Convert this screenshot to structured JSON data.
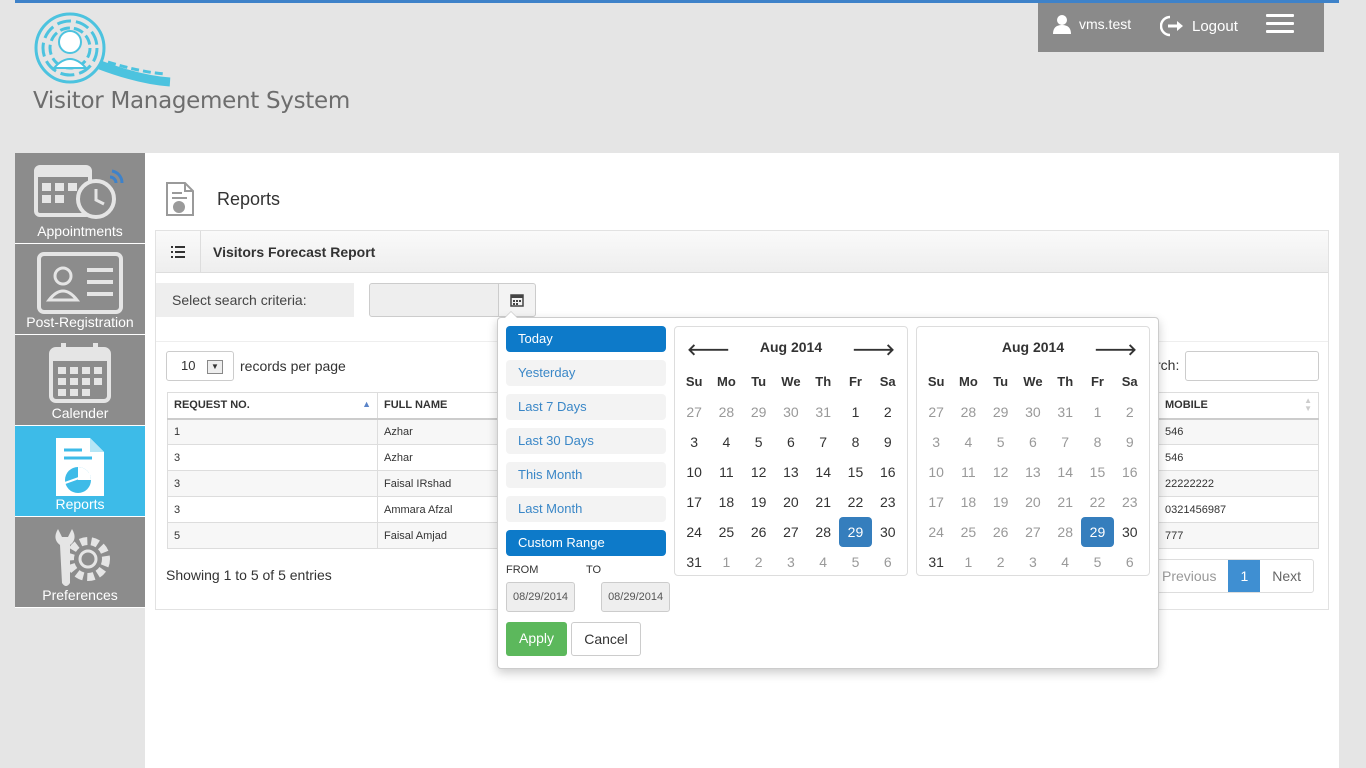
{
  "app": {
    "title": "Visitor Management System"
  },
  "header": {
    "username": "vms.test",
    "logout": "Logout"
  },
  "sidebar": {
    "items": [
      {
        "label": "Appointments"
      },
      {
        "label": "Post-Registration"
      },
      {
        "label": "Calender"
      },
      {
        "label": "Reports"
      },
      {
        "label": "Preferences"
      }
    ]
  },
  "page": {
    "title": "Reports"
  },
  "panel": {
    "title": "Visitors Forecast Report",
    "criteria_label": "Select search criteria:",
    "criteria_value": ""
  },
  "table_controls": {
    "records_per_page_value": "10",
    "records_per_page_label": "records per page",
    "search_label": "rch:",
    "search_value": ""
  },
  "table": {
    "headers": [
      "REQUEST NO.",
      "FULL NAME",
      "MOBILE"
    ],
    "rows": [
      {
        "request_no": "1",
        "full_name": "Azhar",
        "mobile": "546"
      },
      {
        "request_no": "3",
        "full_name": "Azhar",
        "mobile": "546"
      },
      {
        "request_no": "3",
        "full_name": "Faisal IRshad",
        "mobile": "22222222"
      },
      {
        "request_no": "3",
        "full_name": "Ammara Afzal",
        "mobile": "0321456987"
      },
      {
        "request_no": "5",
        "full_name": "Faisal Amjad",
        "mobile": "777"
      }
    ]
  },
  "pagination": {
    "showing": "Showing 1 to 5 of 5 entries",
    "previous": "Previous",
    "current": "1",
    "next": "Next"
  },
  "daterange": {
    "ranges": [
      "Today",
      "Yesterday",
      "Last 7 Days",
      "Last 30 Days",
      "This Month",
      "Last Month",
      "Custom Range"
    ],
    "from_label": "FROM",
    "to_label": "TO",
    "from_value": "08/29/2014",
    "to_value": "08/29/2014",
    "apply": "Apply",
    "cancel": "Cancel",
    "calendars": [
      {
        "month": "Aug 2014"
      },
      {
        "month": "Aug 2014"
      }
    ],
    "weekdays": [
      "Su",
      "Mo",
      "Tu",
      "We",
      "Th",
      "Fr",
      "Sa"
    ]
  }
}
